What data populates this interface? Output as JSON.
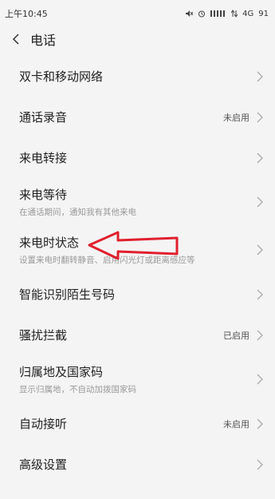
{
  "status_bar": {
    "time": "上午10:45",
    "network": "4G",
    "battery": "91"
  },
  "header": {
    "title": "电话"
  },
  "items": [
    {
      "label": "双卡和移动网络",
      "desc": "",
      "status": ""
    },
    {
      "label": "通话录音",
      "desc": "",
      "status": "未启用"
    },
    {
      "label": "来电转接",
      "desc": "",
      "status": ""
    },
    {
      "label": "来电等待",
      "desc": "在通话期间，通知我有其他来电",
      "status": ""
    },
    {
      "label": "来电时状态",
      "desc": "设置来电时翻转静音、启用闪光灯或距离感应等",
      "status": ""
    },
    {
      "label": "智能识别陌生号码",
      "desc": "",
      "status": ""
    },
    {
      "label": "骚扰拦截",
      "desc": "",
      "status": "已启用"
    },
    {
      "label": "归属地及国家码",
      "desc": "显示归属地，不自动加拨国家码",
      "status": ""
    },
    {
      "label": "自动接听",
      "desc": "",
      "status": "未启用"
    },
    {
      "label": "高级设置",
      "desc": "",
      "status": ""
    }
  ],
  "colors": {
    "background": "#f4f4f4",
    "annotation_arrow": "#e0202e"
  }
}
